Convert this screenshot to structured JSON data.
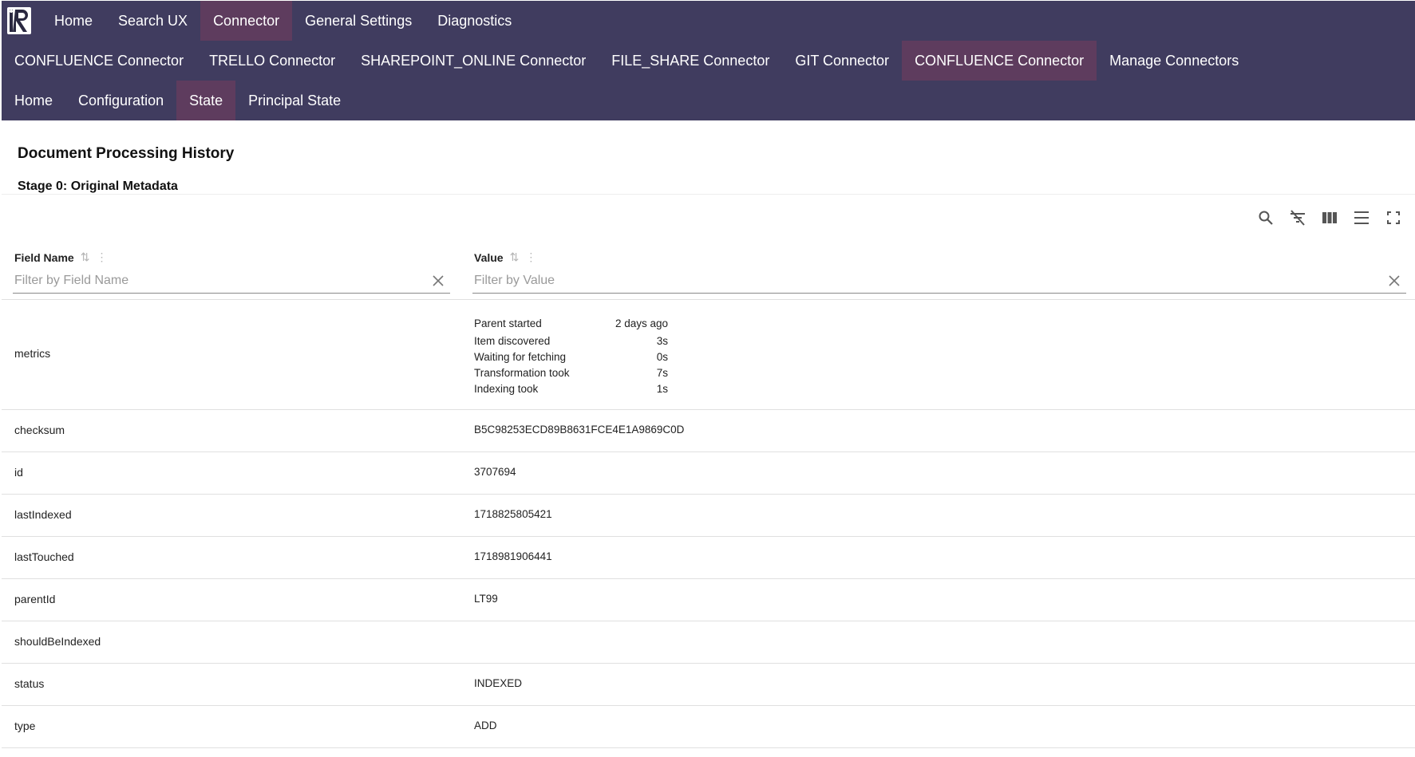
{
  "nav": {
    "primary": [
      {
        "label": "Home",
        "active": false
      },
      {
        "label": "Search UX",
        "active": false
      },
      {
        "label": "Connector",
        "active": true
      },
      {
        "label": "General Settings",
        "active": false
      },
      {
        "label": "Diagnostics",
        "active": false
      }
    ],
    "connectors": [
      {
        "label": "CONFLUENCE Connector",
        "active": false
      },
      {
        "label": "TRELLO Connector",
        "active": false
      },
      {
        "label": "SHAREPOINT_ONLINE Connector",
        "active": false
      },
      {
        "label": "FILE_SHARE Connector",
        "active": false
      },
      {
        "label": "GIT Connector",
        "active": false
      },
      {
        "label": "CONFLUENCE Connector",
        "active": true
      },
      {
        "label": "Manage Connectors",
        "active": false
      }
    ],
    "sub": [
      {
        "label": "Home",
        "active": false
      },
      {
        "label": "Configuration",
        "active": false
      },
      {
        "label": "State",
        "active": true
      },
      {
        "label": "Principal State",
        "active": false
      }
    ]
  },
  "page": {
    "title": "Document Processing History",
    "stage": "Stage 0: Original Metadata"
  },
  "table": {
    "columns": [
      {
        "label": "Field Name",
        "filter_placeholder": "Filter by Field Name",
        "filter_value": ""
      },
      {
        "label": "Value",
        "filter_placeholder": "Filter by Value",
        "filter_value": ""
      }
    ],
    "metrics": {
      "field": "metrics",
      "lines": [
        {
          "label": "Parent started",
          "value": "2 days ago"
        },
        {
          "label": "Item discovered",
          "value": "3s"
        },
        {
          "label": "Waiting for fetching",
          "value": "0s"
        },
        {
          "label": "Transformation took",
          "value": "7s"
        },
        {
          "label": "Indexing took",
          "value": "1s"
        }
      ]
    },
    "rows": [
      {
        "field": "checksum",
        "value": "B5C98253ECD89B8631FCE4E1A9869C0D"
      },
      {
        "field": "id",
        "value": "3707694"
      },
      {
        "field": "lastIndexed",
        "value": "1718825805421"
      },
      {
        "field": "lastTouched",
        "value": "1718981906441"
      },
      {
        "field": "parentId",
        "value": "LT99"
      },
      {
        "field": "shouldBeIndexed",
        "value": ""
      },
      {
        "field": "status",
        "value": "INDEXED"
      },
      {
        "field": "type",
        "value": "ADD"
      }
    ]
  },
  "toolbar": {
    "icons": [
      "search-icon",
      "clear-filters-icon",
      "columns-icon",
      "density-icon",
      "fullscreen-icon"
    ]
  },
  "colors": {
    "nav_bg": "#403c5f",
    "nav_active": "#5e3c5e"
  }
}
